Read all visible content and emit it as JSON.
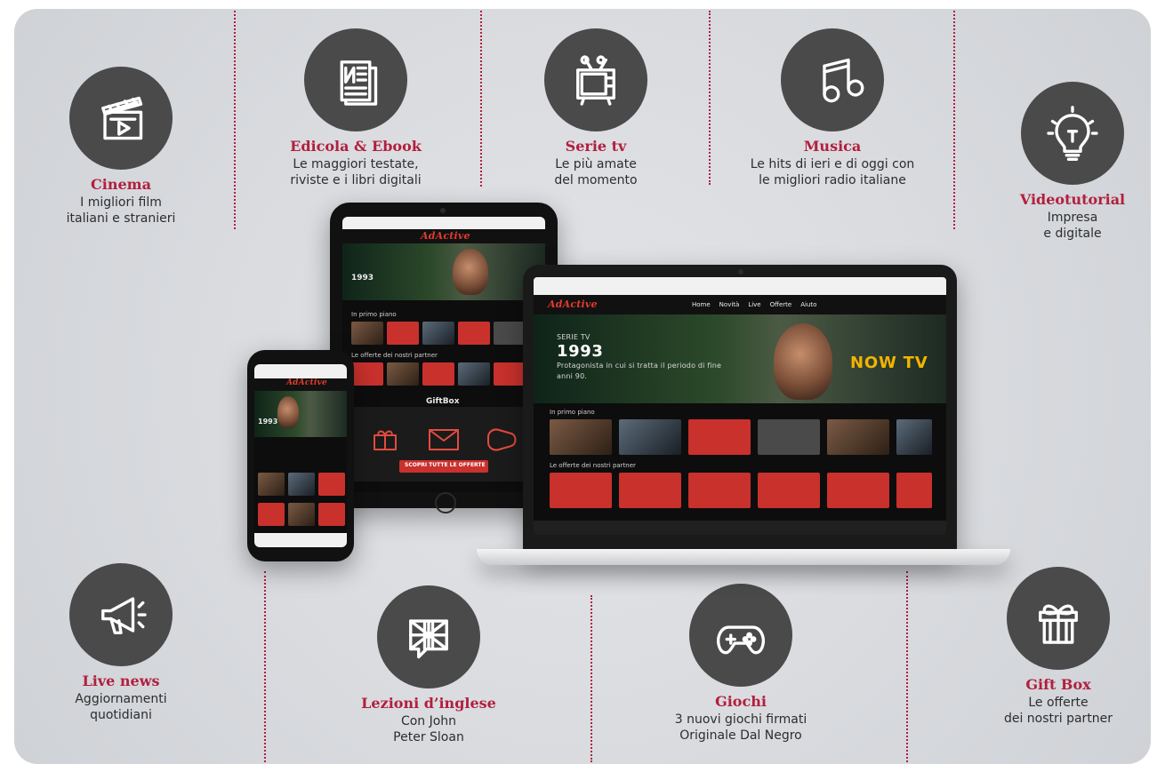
{
  "features": [
    {
      "id": "cinema",
      "title": "Cinema",
      "lines": [
        "I migliori film",
        "italiani e stranieri"
      ],
      "icon": "clapperboard-icon"
    },
    {
      "id": "edicola",
      "title": "Edicola & Ebook",
      "lines": [
        "Le maggiori testate,",
        "riviste e i libri digitali"
      ],
      "icon": "newspaper-icon"
    },
    {
      "id": "serie",
      "title": "Serie tv",
      "lines": [
        "Le più amate",
        "del momento"
      ],
      "icon": "tv-icon"
    },
    {
      "id": "musica",
      "title": "Musica",
      "lines": [
        "Le hits di ieri e di oggi con",
        "le migliori radio italiane"
      ],
      "icon": "music-note-icon"
    },
    {
      "id": "videotutorial",
      "title": "Videotutorial",
      "lines": [
        "Impresa",
        "e digitale"
      ],
      "icon": "lightbulb-icon"
    },
    {
      "id": "livenews",
      "title": "Live news",
      "lines": [
        "Aggiornamenti",
        "quotidiani"
      ],
      "icon": "megaphone-icon"
    },
    {
      "id": "lezioni",
      "title": "Lezioni d’inglese",
      "lines": [
        "Con John",
        "Peter Sloan"
      ],
      "icon": "uk-flag-bubble-icon"
    },
    {
      "id": "giochi",
      "title": "Giochi",
      "lines": [
        "3 nuovi giochi firmati",
        "Originale Dal Negro"
      ],
      "icon": "gamepad-icon"
    },
    {
      "id": "giftbox",
      "title": "Gift Box",
      "lines": [
        "Le offerte",
        "dei nostri partner"
      ],
      "icon": "gift-icon"
    }
  ],
  "devices": {
    "brand_logo_text": "AdActive",
    "nav": [
      "Home",
      "Novità",
      "Live",
      "Offerte",
      "Aiuto"
    ],
    "hero_label": "SERIE TV",
    "hero_title": "1993",
    "hero_subtitle": "Protagonista in cui si tratta il periodo di fine anni 90.",
    "nowtv_text": "NOW TV",
    "row1_label": "In primo piano",
    "row2_label": "Le offerte dei nostri partner",
    "giftbox_title": "GiftBox",
    "giftbox_button": "SCOPRI TUTTE LE OFFERTE"
  },
  "colors": {
    "accent": "#b21f3e",
    "icon_bg": "#4a4a4a",
    "panel_bg": "#d9dbdf"
  }
}
